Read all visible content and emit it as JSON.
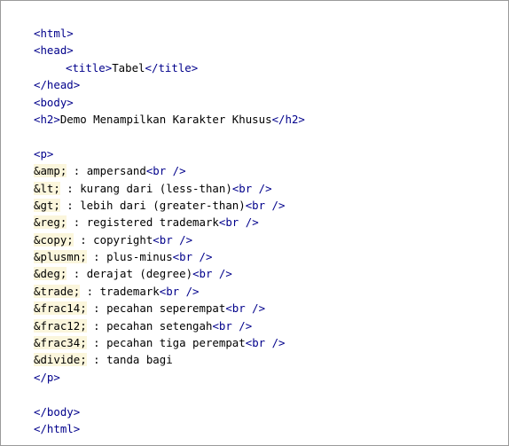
{
  "editor": {
    "lines": [
      [
        {
          "k": "tag",
          "t": "<html>"
        }
      ],
      [
        {
          "k": "tag",
          "t": "<head>"
        }
      ],
      [
        {
          "k": "indent"
        },
        {
          "k": "tag",
          "t": "<title>"
        },
        {
          "k": "txt",
          "t": "Tabel"
        },
        {
          "k": "tag",
          "t": "</title>"
        }
      ],
      [
        {
          "k": "tag",
          "t": "</head>"
        }
      ],
      [
        {
          "k": "tag",
          "t": "<body>"
        }
      ],
      [
        {
          "k": "tag",
          "t": "<h2>"
        },
        {
          "k": "txt",
          "t": "Demo Menampilkan Karakter Khusus"
        },
        {
          "k": "tag",
          "t": "</h2>"
        }
      ],
      [],
      [
        {
          "k": "tag",
          "t": "<p>"
        }
      ],
      [
        {
          "k": "ent",
          "t": "&amp;"
        },
        {
          "k": "txt",
          "t": " : ampersand"
        },
        {
          "k": "tag",
          "t": "<br />"
        }
      ],
      [
        {
          "k": "ent",
          "t": "&lt;"
        },
        {
          "k": "txt",
          "t": " : kurang dari (less-than)"
        },
        {
          "k": "tag",
          "t": "<br />"
        }
      ],
      [
        {
          "k": "ent",
          "t": "&gt;"
        },
        {
          "k": "txt",
          "t": " : lebih dari (greater-than)"
        },
        {
          "k": "tag",
          "t": "<br />"
        }
      ],
      [
        {
          "k": "ent",
          "t": "&reg;"
        },
        {
          "k": "txt",
          "t": " : registered trademark"
        },
        {
          "k": "tag",
          "t": "<br />"
        }
      ],
      [
        {
          "k": "ent",
          "t": "&copy;"
        },
        {
          "k": "txt",
          "t": " : copyright"
        },
        {
          "k": "tag",
          "t": "<br />"
        }
      ],
      [
        {
          "k": "ent",
          "t": "&plusmn;"
        },
        {
          "k": "txt",
          "t": " : plus-minus"
        },
        {
          "k": "tag",
          "t": "<br />"
        }
      ],
      [
        {
          "k": "ent",
          "t": "&deg;"
        },
        {
          "k": "txt",
          "t": " : derajat (degree)"
        },
        {
          "k": "tag",
          "t": "<br />"
        }
      ],
      [
        {
          "k": "ent",
          "t": "&trade;"
        },
        {
          "k": "txt",
          "t": " : trademark"
        },
        {
          "k": "tag",
          "t": "<br />"
        }
      ],
      [
        {
          "k": "ent",
          "t": "&frac14;"
        },
        {
          "k": "txt",
          "t": " : pecahan seperempat"
        },
        {
          "k": "tag",
          "t": "<br />"
        }
      ],
      [
        {
          "k": "ent",
          "t": "&frac12;"
        },
        {
          "k": "txt",
          "t": " : pecahan setengah"
        },
        {
          "k": "tag",
          "t": "<br />"
        }
      ],
      [
        {
          "k": "ent",
          "t": "&frac34;"
        },
        {
          "k": "txt",
          "t": " : pecahan tiga perempat"
        },
        {
          "k": "tag",
          "t": "<br />"
        }
      ],
      [
        {
          "k": "ent",
          "t": "&divide;"
        },
        {
          "k": "txt",
          "t": " : tanda bagi"
        }
      ],
      [
        {
          "k": "tag",
          "t": "</p>"
        }
      ],
      [],
      [
        {
          "k": "tag",
          "t": "</body>"
        }
      ],
      [
        {
          "k": "tag",
          "t": "</html>"
        }
      ]
    ]
  },
  "colors": {
    "tag": "#00008b",
    "text": "#000000",
    "entity_highlight": "#fbf6dc",
    "border": "#9a9a9a"
  }
}
